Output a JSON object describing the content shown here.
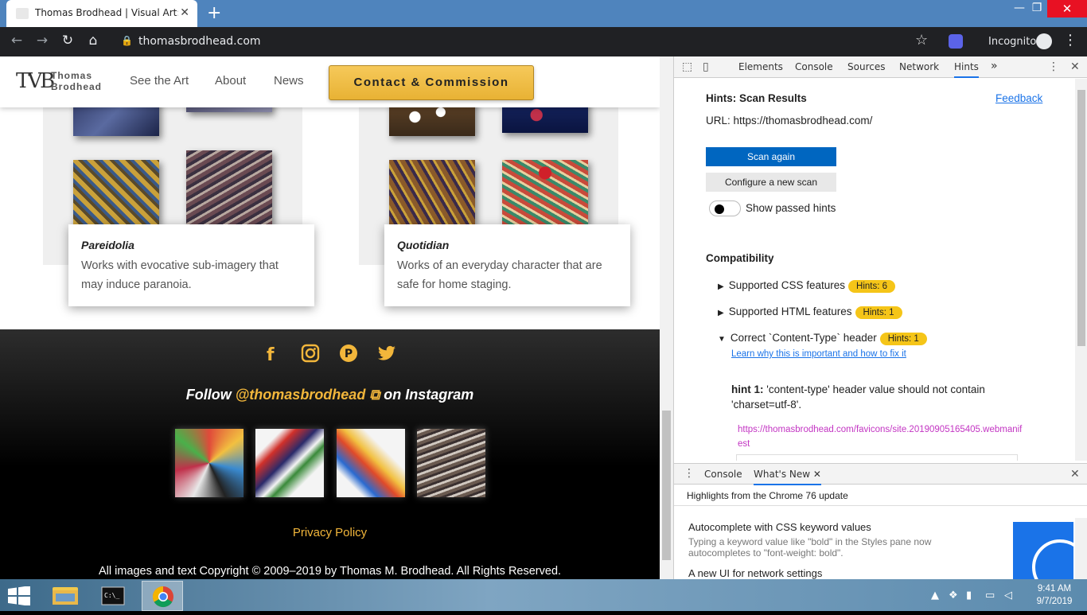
{
  "browser": {
    "tab_title": "Thomas Brodhead | Visual Art: O",
    "tab_close": "✕",
    "new_tab": "+",
    "window_controls": {
      "minimize": "—",
      "restore": "❐",
      "close": "✕"
    },
    "nav": {
      "back": "←",
      "forward": "→",
      "reload": "↻",
      "home": "⌂"
    },
    "url": "thomasbrodhead.com",
    "incognito_label": "Incognito",
    "menu": "⋮"
  },
  "site": {
    "logo_mark": "TVB",
    "logo_text_1": "Thomas",
    "logo_text_2": "Brodhead",
    "nav_links": [
      "See the Art",
      "About",
      "News"
    ],
    "contact_button": "Contact & Commission",
    "galleries": [
      {
        "title": "Pareidolia",
        "desc_line1": "Works with evocative sub-imagery that",
        "desc_line2": "may induce paranoia."
      },
      {
        "title": "Quotidian",
        "desc_line1": "Works of an everyday character that are",
        "desc_line2": "safe for home staging."
      }
    ],
    "footer": {
      "social_icons": [
        "facebook-icon",
        "instagram-icon",
        "pinterest-icon",
        "twitter-icon"
      ],
      "social_glyphs": [
        "f",
        "◎",
        "℗",
        "🐦"
      ],
      "follow_prefix": "Follow ",
      "follow_handle": "@thomasbrodhead",
      "follow_ext": "⧉",
      "follow_suffix": " on Instagram",
      "privacy": "Privacy Policy",
      "copyright": "All images and text Copyright © 2009–2019 by Thomas M. Brodhead. All Rights Reserved."
    }
  },
  "devtools": {
    "tabs": [
      "Elements",
      "Console",
      "Sources",
      "Network",
      "Hints"
    ],
    "more": "»",
    "hints": {
      "title": "Hints: Scan Results",
      "feedback": "Feedback",
      "url": "URL: https://thomasbrodhead.com/",
      "scan_again": "Scan again",
      "configure": "Configure a new scan",
      "show_passed": "Show passed hints",
      "compat_title": "Compatibility",
      "rows": [
        {
          "arrow": "▶",
          "label": "Supported CSS features",
          "badge": "Hints: 6"
        },
        {
          "arrow": "▶",
          "label": "Supported HTML features",
          "badge": "Hints: 1"
        },
        {
          "arrow": "▼",
          "label": "Correct `Content-Type` header",
          "badge": "Hints: 1"
        }
      ],
      "learn_link": "Learn why this is important and how to fix it",
      "hint1_label": "hint 1:",
      "hint1_text": " 'content-type' header value should not contain 'charset=utf-8'.",
      "hint1_url": "https://thomasbrodhead.com/favicons/site.20190905165405.webmanifest"
    },
    "drawer": {
      "tabs": [
        "Console",
        "What's New"
      ],
      "close_tab": "✕",
      "highlight": "Highlights from the Chrome 76 update",
      "item1_title": "Autocomplete with CSS keyword values",
      "item1_desc": "Typing a keyword value like \"bold\" in the Styles pane now autocompletes to \"font-weight: bold\".",
      "item2_title": "A new UI for network settings"
    }
  },
  "taskbar": {
    "time": "9:41 AM",
    "date": "9/7/2019"
  }
}
